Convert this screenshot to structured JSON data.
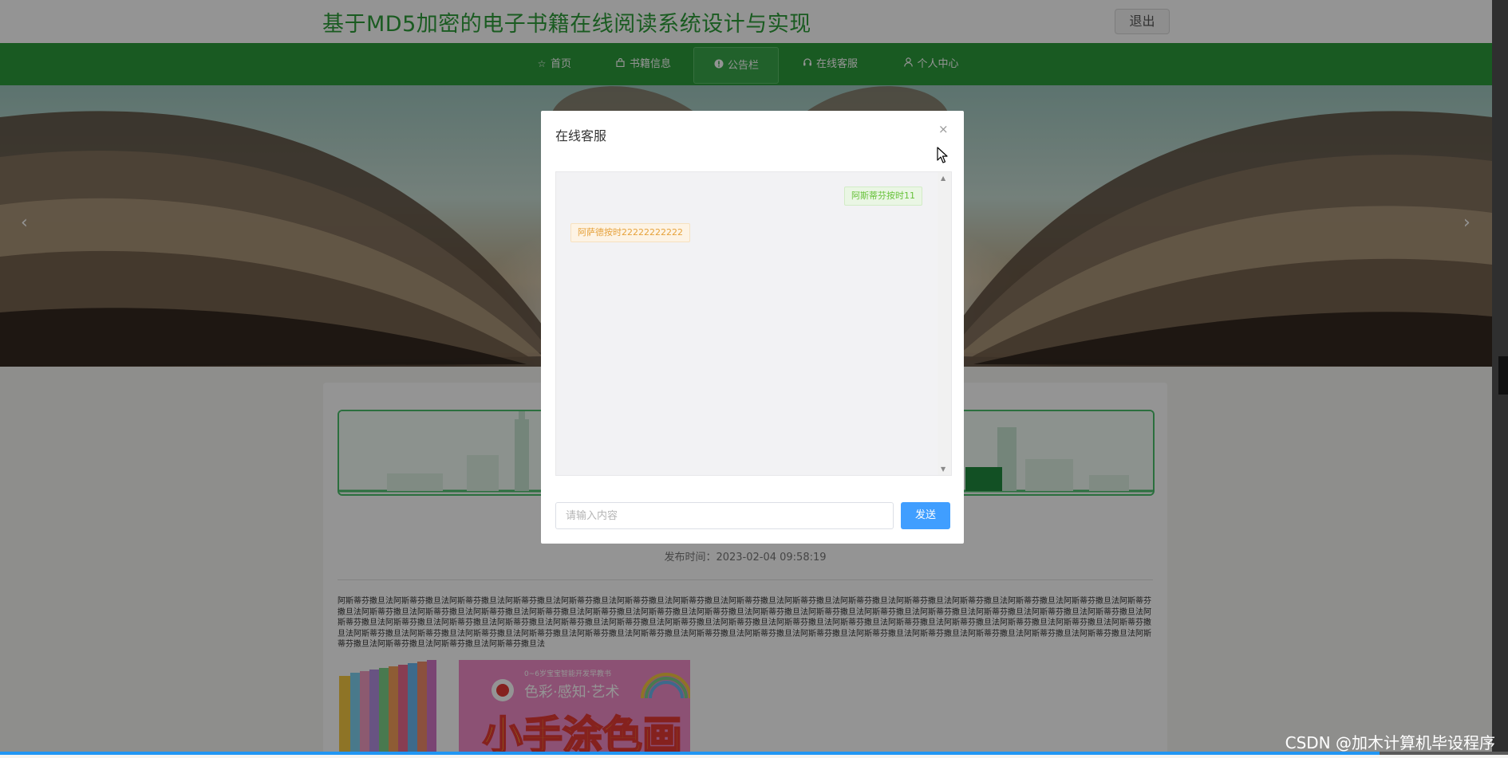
{
  "header": {
    "site_title": "基于MD5加密的电子书籍在线阅读系统设计与实现",
    "logout_label": "退出"
  },
  "nav": {
    "items": [
      {
        "label": "首页",
        "icon": "star-icon"
      },
      {
        "label": "书籍信息",
        "icon": "bag-icon"
      },
      {
        "label": "公告栏",
        "icon": "info-circle-icon"
      },
      {
        "label": "在线客服",
        "icon": "headset-icon"
      },
      {
        "label": "个人中心",
        "icon": "user-icon"
      }
    ],
    "active": "公告栏"
  },
  "banner": {
    "prev_arrow": "‹",
    "next_arrow": "›"
  },
  "article": {
    "publish_time": "发布时间：2023-02-04 09:58:19",
    "body_text": "阿斯蒂芬撒旦法阿斯蒂芬撒旦法阿斯蒂芬撒旦法阿斯蒂芬撒旦法阿斯蒂芬撒旦法阿斯蒂芬撒旦法阿斯蒂芬撒旦法阿斯蒂芬撒旦法阿斯蒂芬撒旦法阿斯蒂芬撒旦法阿斯蒂芬撒旦法阿斯蒂芬撒旦法阿斯蒂芬撒旦法阿斯蒂芬撒旦法阿斯蒂芬撒旦法阿斯蒂芬撒旦法阿斯蒂芬撒旦法阿斯蒂芬撒旦法阿斯蒂芬撒旦法阿斯蒂芬撒旦法阿斯蒂芬撒旦法阿斯蒂芬撒旦法阿斯蒂芬撒旦法阿斯蒂芬撒旦法阿斯蒂芬撒旦法阿斯蒂芬撒旦法阿斯蒂芬撒旦法阿斯蒂芬撒旦法阿斯蒂芬撒旦法阿斯蒂芬撒旦法阿斯蒂芬撒旦法阿斯蒂芬撒旦法阿斯蒂芬撒旦法阿斯蒂芬撒旦法阿斯蒂芬撒旦法阿斯蒂芬撒旦法阿斯蒂芬撒旦法阿斯蒂芬撒旦法阿斯蒂芬撒旦法阿斯蒂芬撒旦法阿斯蒂芬撒旦法阿斯蒂芬撒旦法阿斯蒂芬撒旦法阿斯蒂芬撒旦法阿斯蒂芬撒旦法阿斯蒂芬撒旦法阿斯蒂芬撒旦法阿斯蒂芬撒旦法阿斯蒂芬撒旦法阿斯蒂芬撒旦法阿斯蒂芬撒旦法阿斯蒂芬撒旦法阿斯蒂芬撒旦法阿斯蒂芬撒旦法阿斯蒂芬撒旦法阿斯蒂芬撒旦法阿斯蒂芬撒旦法阿斯蒂芬撒旦法阿斯蒂芬撒旦法阿斯蒂芬撒旦法阿斯蒂芬撒旦法阿斯蒂芬撒旦法",
    "book_cover": {
      "series_text": "0~6岁宝宝智能开发早教书",
      "subtitle": "色彩·感知·艺术",
      "title": "小手涂色画"
    }
  },
  "chat_modal": {
    "title": "在线客服",
    "close_symbol": "×",
    "messages": [
      {
        "side": "right",
        "text": "阿斯蒂芬按时11"
      },
      {
        "side": "left",
        "text": "阿萨德按时22222222222"
      }
    ],
    "input_placeholder": "请输入内容",
    "send_label": "发送"
  },
  "progress": {
    "fraction": 0.915
  },
  "watermark": "CSDN @加木计算机毕设程序"
}
